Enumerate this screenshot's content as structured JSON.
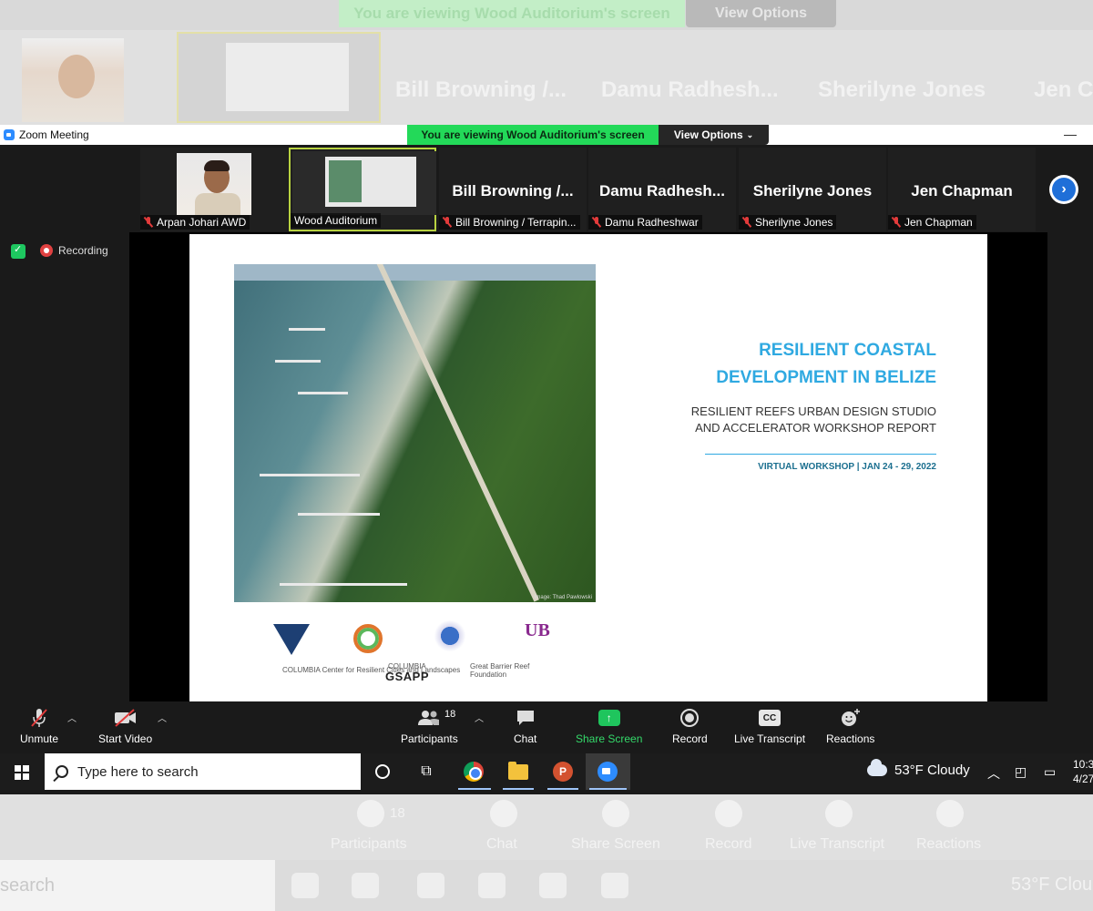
{
  "background": {
    "banner_text": "You are viewing Wood Auditorium's screen",
    "view_options": "View Options",
    "names": [
      "Bill Browning /...",
      "Damu  Radhesh...",
      "Sherilyne Jones",
      "Jen Ch"
    ],
    "toolbar": {
      "participants_count": "18",
      "participants": "Participants",
      "chat": "Chat",
      "share_screen": "Share Screen",
      "record": "Record",
      "live_transcript": "Live Transcript",
      "reactions": "Reactions"
    },
    "search": "search",
    "weather": "53°F  Clou"
  },
  "window": {
    "title": "Zoom Meeting",
    "minimize": "—",
    "viewing_banner": "You are viewing Wood Auditorium's screen",
    "view_options": "View Options"
  },
  "participants_strip": {
    "tiles": [
      {
        "label": "Arpan Johari AWD",
        "muted": true
      },
      {
        "label": "Wood Auditorium",
        "muted": false,
        "active": true
      },
      {
        "big": "Bill Browning /...",
        "label": "Bill Browning / Terrapin...",
        "muted": true
      },
      {
        "big": "Damu  Radhesh...",
        "label": "Damu Radheshwar",
        "muted": true
      },
      {
        "big": "Sherilyne Jones",
        "label": "Sherilyne Jones",
        "muted": true
      },
      {
        "big": "Jen Chapman",
        "label": "Jen Chapman",
        "muted": true
      }
    ],
    "next": "›"
  },
  "recording": {
    "label": "Recording"
  },
  "slide": {
    "title_line1": "RESILIENT COASTAL",
    "title_line2": "DEVELOPMENT IN BELIZE",
    "sub_line1": "RESILIENT REEFS URBAN DESIGN STUDIO",
    "sub_line2": "AND ACCELERATOR WORKSHOP REPORT",
    "date": "VIRTUAL WORKSHOP | JAN 24 - 29, 2022",
    "photo_credit": "Image: Thad Pawlowski",
    "logos": {
      "columbia_center": "COLUMBIA  Center for Resilient Cities and Landscapes",
      "gsapp_top": "COLUMBIA",
      "gsapp": "GSAPP",
      "ub": "UB",
      "gbrf": "Great Barrier Reef Foundation"
    }
  },
  "toolbar": {
    "unmute": "Unmute",
    "start_video": "Start Video",
    "participants_count": "18",
    "participants": "Participants",
    "chat": "Chat",
    "share_screen": "Share Screen",
    "record": "Record",
    "live_transcript": "Live Transcript",
    "reactions": "Reactions",
    "cc": "CC"
  },
  "taskbar": {
    "search_placeholder": "Type here to search",
    "weather": "53°F  Cloudy",
    "time": "10:3",
    "date": "4/27"
  },
  "colors": {
    "zoom_blue": "#2d8cff",
    "banner_green": "#23d959",
    "slide_title": "#2fa9e1",
    "recording_red": "#e04141"
  }
}
